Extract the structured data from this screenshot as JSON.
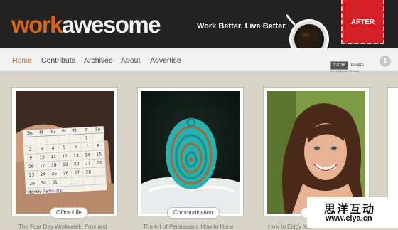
{
  "header": {
    "logo_part1": "work",
    "logo_part2": "awesome",
    "tagline": "Work Better. Live Better.",
    "badge": "AFTER"
  },
  "nav": {
    "items": [
      {
        "label": "Home",
        "active": true
      },
      {
        "label": "Contribute",
        "active": false
      },
      {
        "label": "Archives",
        "active": false
      },
      {
        "label": "About",
        "active": false
      },
      {
        "label": "Advertise",
        "active": false
      }
    ]
  },
  "feedburner": {
    "count": "12038",
    "label": "readers",
    "by": "BY FEEDBURNER"
  },
  "twitter_icon": "t",
  "calendar": {
    "days": [
      "Su",
      "M",
      "Tu",
      "W",
      "Th",
      "F",
      "Sa"
    ],
    "rows": [
      [
        "",
        "",
        "",
        "",
        "",
        "1",
        ""
      ],
      [
        "2",
        "3",
        "4",
        "5",
        "6",
        "7",
        "8"
      ],
      [
        "9",
        "10",
        "11",
        "12",
        "13",
        "14",
        "15"
      ],
      [
        "16",
        "17",
        "18",
        "19",
        "20",
        "21",
        "22"
      ],
      [
        "23",
        "24",
        "25",
        "26",
        "27",
        "28",
        ""
      ],
      [
        "29",
        "30",
        "31",
        "",
        "",
        "",
        ""
      ]
    ],
    "month_label": "Month",
    "month_value": "February"
  },
  "cards": [
    {
      "category": "Office Life",
      "title": "The Four Day Workweek: Pros and"
    },
    {
      "category": "Communication",
      "title": "The Art of Persuasion: How to Hone"
    },
    {
      "category": "",
      "title": "How to Enjoy Your Job"
    }
  ],
  "watermark": {
    "cn": "思洋互动",
    "url": "www.ciya.cn"
  },
  "colors": {
    "brand_orange": "#d9661f",
    "header_bg": "#222222",
    "badge_red": "#d51f26",
    "page_bg": "#d8d4c8"
  }
}
